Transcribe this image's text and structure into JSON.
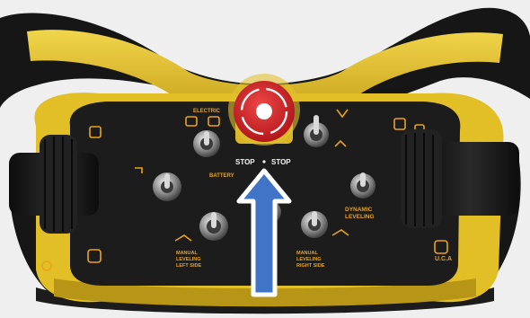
{
  "photo": {
    "subject": "remote-control-panel",
    "colors": {
      "background": "#efefef",
      "housing_yellow": "#e7c62b",
      "housing_shadow": "#b79516",
      "grip_black": "#161616",
      "faceplate": "#1c1c1c",
      "label_orange": "#e9a21a",
      "estop_red": "#d7262a",
      "arrow_blue": "#3f74c6"
    }
  },
  "labels": {
    "electric": "ELECTRIC",
    "battery": "BATTERY",
    "stop_left": "STOP",
    "stop_right": "STOP",
    "dynamic": "DYNAMIC",
    "leveling": "LEVELING",
    "manual_left_1": "MANUAL",
    "manual_left_2": "LEVELING",
    "manual_left_3": "LEFT SIDE",
    "manual_right_1": "MANUAL",
    "manual_right_2": "LEVELING",
    "manual_right_3": "RIGHT SIDE",
    "brand": "U.C.A"
  }
}
